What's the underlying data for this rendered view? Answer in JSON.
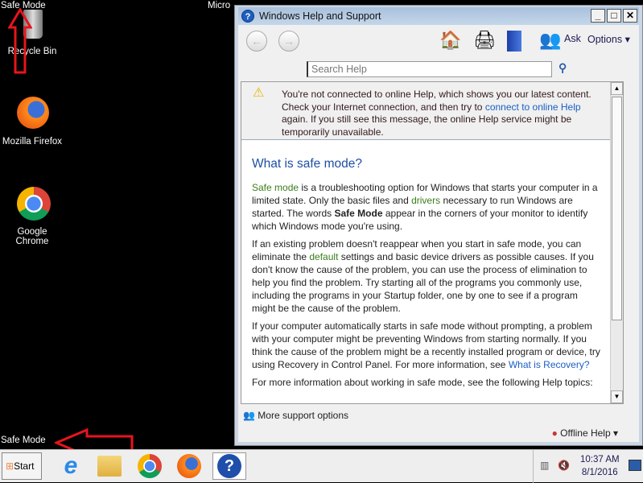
{
  "desktop": {
    "safe_mode_tl": "Safe Mode",
    "safe_mode_tr": "Micro",
    "safe_mode_bl": "Safe Mode",
    "icons": [
      {
        "label": "Recycle Bin",
        "icon": "recycle-bin-icon"
      },
      {
        "label": "Mozilla Firefox",
        "icon": "firefox-icon"
      },
      {
        "label": "Google Chrome",
        "icon": "chrome-icon"
      }
    ]
  },
  "window": {
    "title": "Windows Help and Support",
    "toolbar": {
      "ask": "Ask",
      "options": "Options"
    },
    "search_placeholder": "Search Help",
    "warning": {
      "pre": "You're not connected to online Help, which shows you our latest content. Check your Internet connection, and then try to ",
      "link": "connect to online Help",
      "post": " again. If you still see this message, the online Help service might be temporarily unavailable."
    },
    "article": {
      "heading": "What is safe mode?",
      "p1": {
        "t1": "Safe mode",
        "t2": " is a troubleshooting option for Windows that starts your computer in a limited state. Only the basic files and ",
        "t3": "drivers",
        "t4": " necessary to run Windows are started. The words ",
        "t5": "Safe Mode",
        "t6": " appear in the corners of your monitor to identify which Windows mode you're using."
      },
      "p2": {
        "t1": "If an existing problem doesn't reappear when you start in safe mode, you can eliminate the ",
        "t2": "default",
        "t3": " settings and basic device drivers as possible causes. If you don't know the cause of the problem, you can use the process of elimination to help you find the problem. Try starting all of the programs you commonly use, including the programs in your Startup folder, one by one to see if a program might be the cause of the problem."
      },
      "p3": {
        "t1": "If your computer automatically starts in safe mode without prompting, a problem with your computer might be preventing Windows from starting normally. If you think the cause of the problem might be a recently installed program or device, try using Recovery in Control Panel. For more information, see ",
        "t2": "What is Recovery?"
      },
      "p4": "For more information about working in safe mode, see the following Help topics:"
    },
    "more_support": "More support options",
    "offline_help": "Offline Help"
  },
  "taskbar": {
    "start": "Start",
    "time": "10:37 AM",
    "date": "8/1/2016"
  },
  "colors": {
    "arrow": "#e8141c",
    "link": "#1a5fc4",
    "glossary": "#3a7d1a"
  }
}
